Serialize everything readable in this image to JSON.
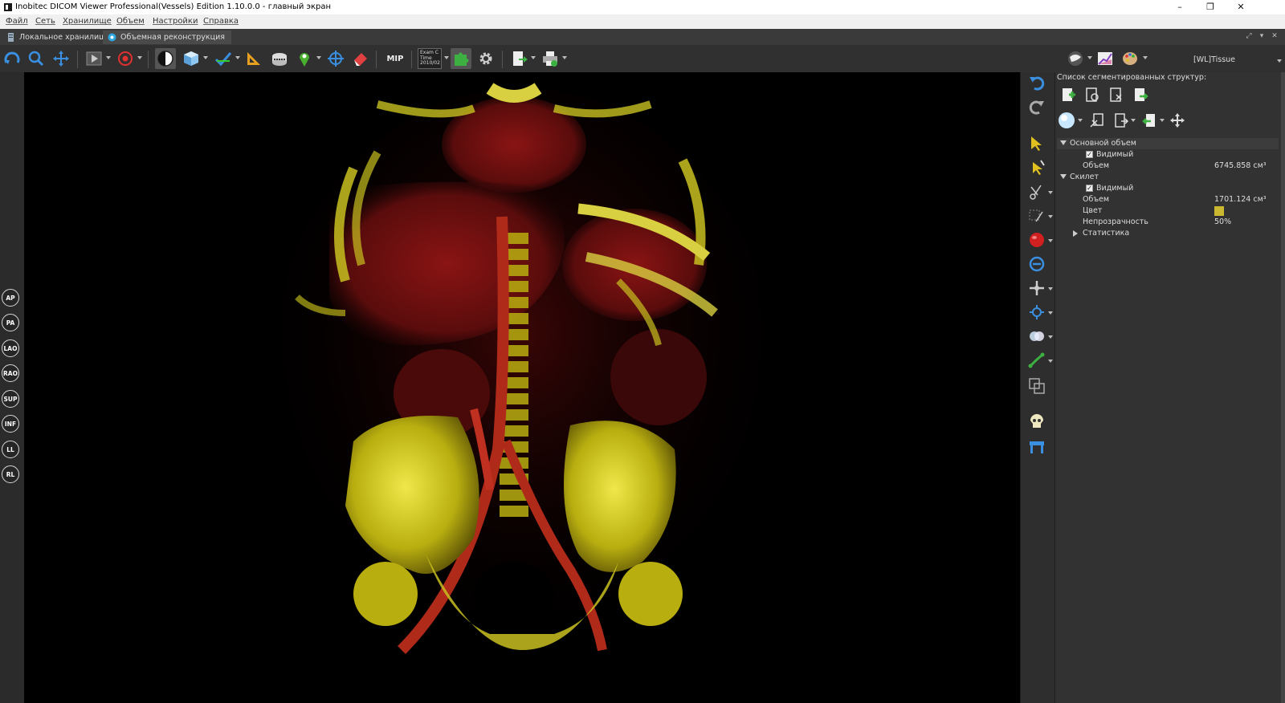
{
  "window": {
    "title": "Inobitec DICOM Viewer Professional(Vessels) Edition 1.10.0.0 - главный экран",
    "minimize": "–",
    "restore": "❐",
    "close": "✕"
  },
  "menu": [
    "Файл",
    "Сеть",
    "Хранилище",
    "Объем",
    "Настройки",
    "Справка"
  ],
  "tabs": [
    {
      "label": "Локальное хранилище"
    },
    {
      "label": "Объемная реконструкция",
      "active": true
    }
  ],
  "tab_controls": [
    "⤢",
    "▾",
    "✕"
  ],
  "toolbar": {
    "mip_label": "MIP",
    "exam_line1": "Exam C",
    "exam_line2": "Time",
    "exam_line3": "2010/02",
    "wl_preset": "[WL]Tissue"
  },
  "orientation_buttons": [
    "AP",
    "PA",
    "LAO",
    "RAO",
    "SUP",
    "INF",
    "LL",
    "RL"
  ],
  "panel": {
    "title": "Список сегментированных структур:",
    "structures": [
      {
        "name": "Основной объем",
        "visible_label": "Видимый",
        "volume_label": "Объем",
        "volume_value": "6745.858 см³"
      },
      {
        "name": "Скилет",
        "visible_label": "Видимый",
        "volume_label": "Объем",
        "volume_value": "1701.124 см³",
        "color_label": "Цвет",
        "color": "#c9b830",
        "opacity_label": "Непрозрачность",
        "opacity_value": "50%",
        "stats_label": "Статистика"
      }
    ]
  },
  "colors": {
    "bone": "#d4cc1a",
    "soft_tissue": "#7a1010",
    "accent_blue": "#3a8fe0"
  }
}
